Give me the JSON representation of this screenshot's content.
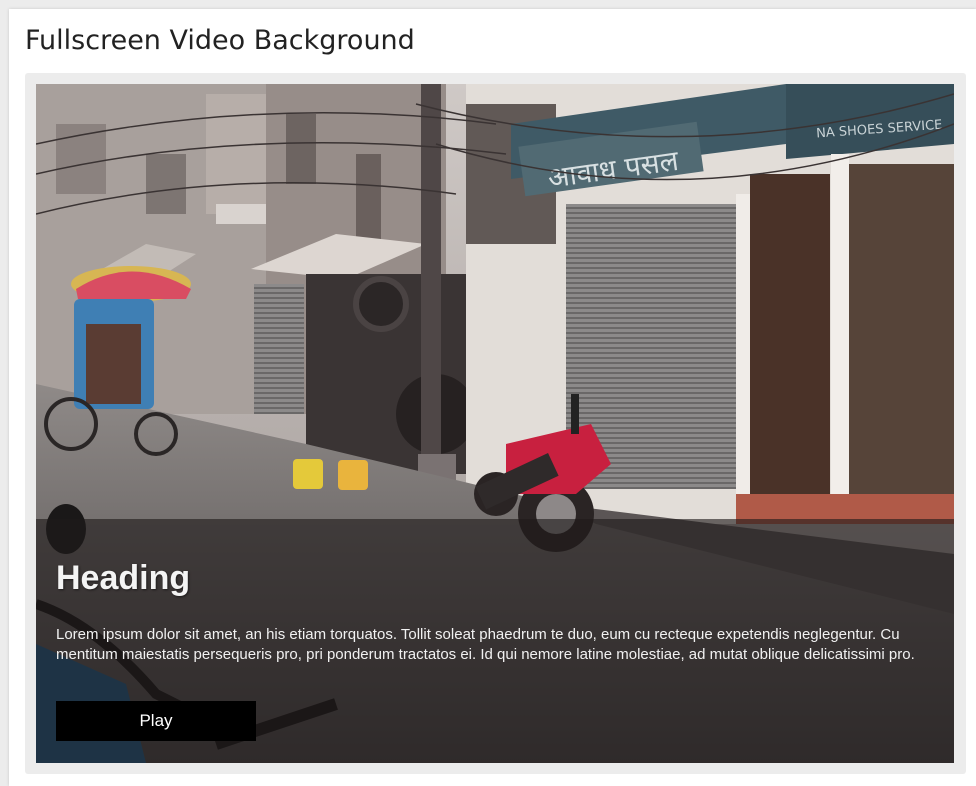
{
  "page": {
    "title": "Fullscreen Video Background"
  },
  "video": {
    "shop_sign_left": "आवाध पसल",
    "shop_sign_right": "NA SHOES SERVICE"
  },
  "overlay": {
    "heading": "Heading",
    "text": "Lorem ipsum dolor sit amet, an his etiam torquatos. Tollit soleat phaedrum te duo, eum cu recteque expetendis neglegentur. Cu mentitum maiestatis persequeris pro, pri ponderum tractatos ei. Id qui nemore latine molestiae, ad mutat oblique delicatissimi pro.",
    "button_label": "Play"
  },
  "colors": {
    "overlay_background": "#1e1a1a",
    "button_background": "#000000",
    "button_text": "#ffffff"
  }
}
